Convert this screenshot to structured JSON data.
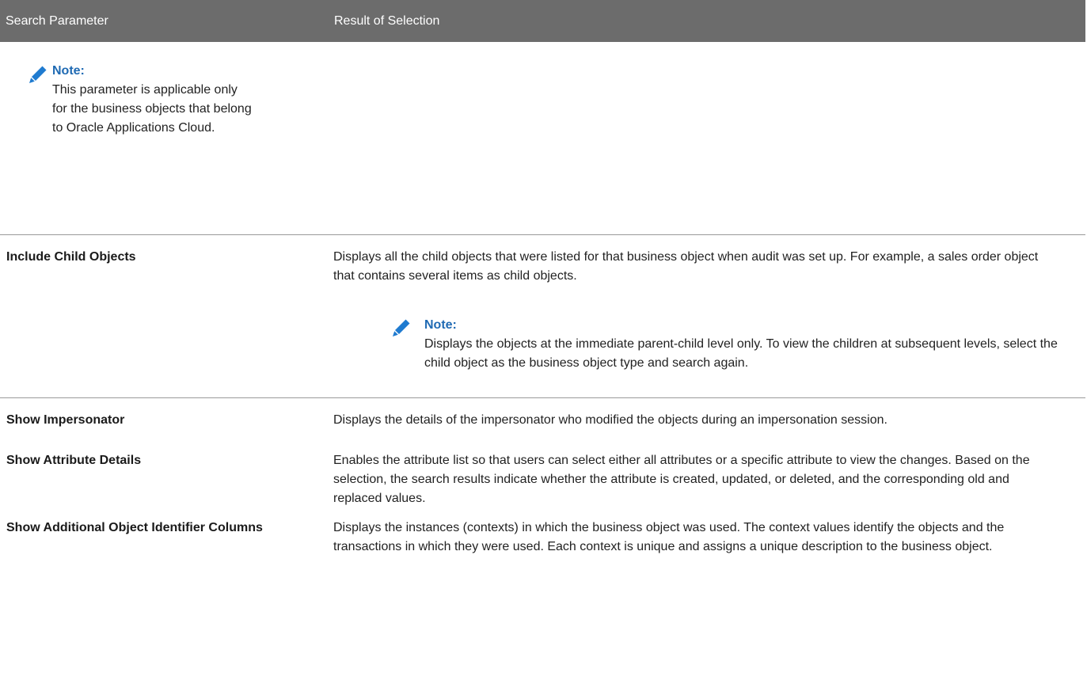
{
  "table": {
    "headers": [
      "Search Parameter",
      "Result of Selection"
    ],
    "continued_note": {
      "icon": "pencil-icon",
      "title": "Note:",
      "body": "This parameter is applicable only for the business objects that belong to Oracle Applications Cloud."
    },
    "rows": [
      {
        "parameter": "Include Child Objects",
        "result": "Displays all the child objects that were listed for that business object when audit was set up. For example, a sales order object that contains several items as child objects.",
        "note": {
          "icon": "pencil-icon",
          "title": "Note:",
          "body": "Displays the objects at the immediate parent-child level only. To view the children at subsequent levels, select the child object as the business object type and search again."
        }
      },
      {
        "parameter": "Show Impersonator",
        "result": "Displays the details of the impersonator who modified the objects during an impersonation session."
      },
      {
        "parameter": "Show Attribute Details",
        "result": "Enables the attribute list so that users can select either all attributes or a specific attribute to view the changes. Based on the selection, the search results indicate whether the attribute is created, updated, or deleted, and the corresponding old and replaced values."
      },
      {
        "parameter": "Show Additional Object Identifier Columns",
        "result": "Displays the instances (contexts) in which the business object was used. The context values identify the objects and the transactions in which they were used. Each context is unique and assigns a unique description to the business object."
      }
    ]
  },
  "colors": {
    "header_bg": "#6c6c6c",
    "note_title": "#1f6ab3",
    "pencil_icon": "#1f7bd0",
    "row_separator": "#9a9a9a"
  }
}
